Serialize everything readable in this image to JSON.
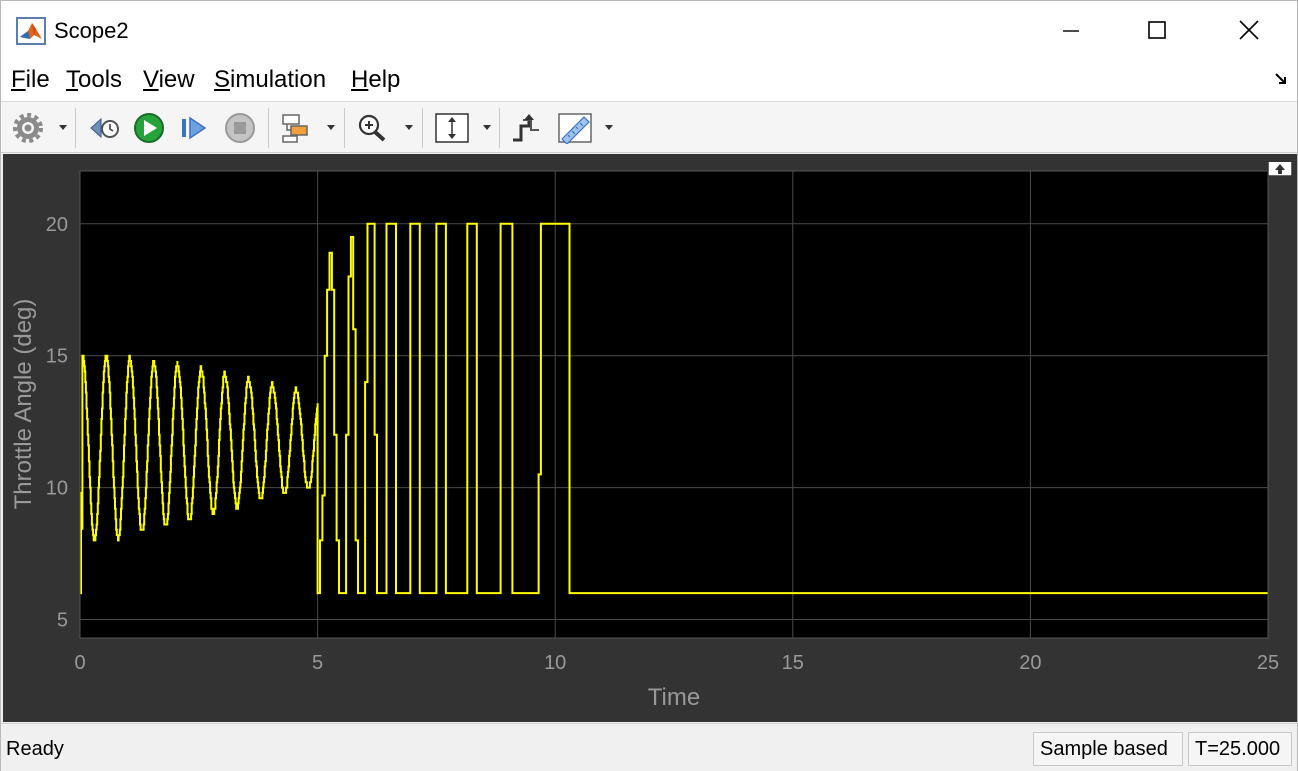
{
  "window": {
    "title": "Scope2"
  },
  "menu": {
    "file": {
      "first": "F",
      "rest": "ile"
    },
    "tools": {
      "first": "T",
      "rest": "ools"
    },
    "view": {
      "first": "V",
      "rest": "iew"
    },
    "simulation": {
      "first": "S",
      "rest": "imulation"
    },
    "help": {
      "first": "H",
      "rest": "elp"
    }
  },
  "toolbar_icons": [
    "gear-icon",
    "step-back-icon",
    "run-icon",
    "step-forward-icon",
    "stop-icon",
    "highlight-block-icon",
    "zoom-in-icon",
    "scale-axes-icon",
    "triggers-icon",
    "cursor-measurements-icon"
  ],
  "status": {
    "ready": "Ready",
    "mode": "Sample based",
    "time": "T=25.000"
  },
  "colors": {
    "plot_bg": "#000000",
    "figure_bg": "#333333",
    "trace": "#ffff00",
    "grid": "#4a4a4a",
    "axis_text": "#999999"
  },
  "chart_data": {
    "type": "line",
    "title": "",
    "xlabel": "Time",
    "ylabel": "Throttle Angle (deg)",
    "xlim": [
      0,
      25
    ],
    "ylim": [
      4.3,
      22
    ],
    "xticks": [
      0,
      5,
      10,
      15,
      20,
      25
    ],
    "yticks": [
      5,
      10,
      15,
      20
    ],
    "grid": true,
    "series": [
      {
        "color": "#ffff00",
        "oscillation": {
          "t_start": 0,
          "t_end": 5,
          "period": 0.5,
          "peaks": [
            15.0,
            14.95,
            14.8,
            14.7,
            14.55,
            14.4,
            14.2,
            14.0,
            13.8,
            13.6
          ],
          "troughs": [
            8.0,
            8.1,
            8.3,
            8.5,
            8.75,
            9.0,
            9.25,
            9.5,
            9.7,
            9.9
          ]
        },
        "pulses": [
          [
            5.0,
            6.0
          ],
          [
            5.05,
            8.0
          ],
          [
            5.1,
            9.7
          ],
          [
            5.15,
            15.0
          ],
          [
            5.2,
            17.5
          ],
          [
            5.25,
            18.9
          ],
          [
            5.3,
            17.5
          ],
          [
            5.35,
            12.0
          ],
          [
            5.4,
            8.0
          ],
          [
            5.45,
            6.0
          ],
          [
            5.55,
            6.0
          ],
          [
            5.6,
            12.0
          ],
          [
            5.65,
            18.0
          ],
          [
            5.7,
            19.5
          ],
          [
            5.75,
            16.0
          ],
          [
            5.8,
            8.0
          ],
          [
            5.85,
            6.0
          ],
          [
            5.95,
            6.0
          ],
          [
            6.0,
            14.0
          ],
          [
            6.05,
            20.0
          ],
          [
            6.15,
            20.0
          ],
          [
            6.2,
            12.0
          ],
          [
            6.25,
            6.0
          ],
          [
            6.4,
            6.0
          ],
          [
            6.45,
            20.0
          ],
          [
            6.6,
            20.0
          ],
          [
            6.65,
            6.0
          ],
          [
            6.9,
            6.0
          ],
          [
            6.95,
            20.0
          ],
          [
            7.1,
            20.0
          ],
          [
            7.15,
            6.0
          ],
          [
            7.45,
            6.0
          ],
          [
            7.5,
            20.0
          ],
          [
            7.65,
            20.0
          ],
          [
            7.7,
            6.0
          ],
          [
            8.1,
            6.0
          ],
          [
            8.15,
            20.0
          ],
          [
            8.3,
            20.0
          ],
          [
            8.35,
            6.0
          ],
          [
            8.8,
            6.0
          ],
          [
            8.85,
            20.0
          ],
          [
            9.05,
            20.0
          ],
          [
            9.1,
            6.0
          ],
          [
            9.6,
            6.0
          ],
          [
            9.65,
            10.5
          ],
          [
            9.7,
            20.0
          ],
          [
            10.25,
            20.0
          ],
          [
            10.3,
            6.0
          ],
          [
            25.0,
            6.0
          ]
        ]
      }
    ]
  }
}
